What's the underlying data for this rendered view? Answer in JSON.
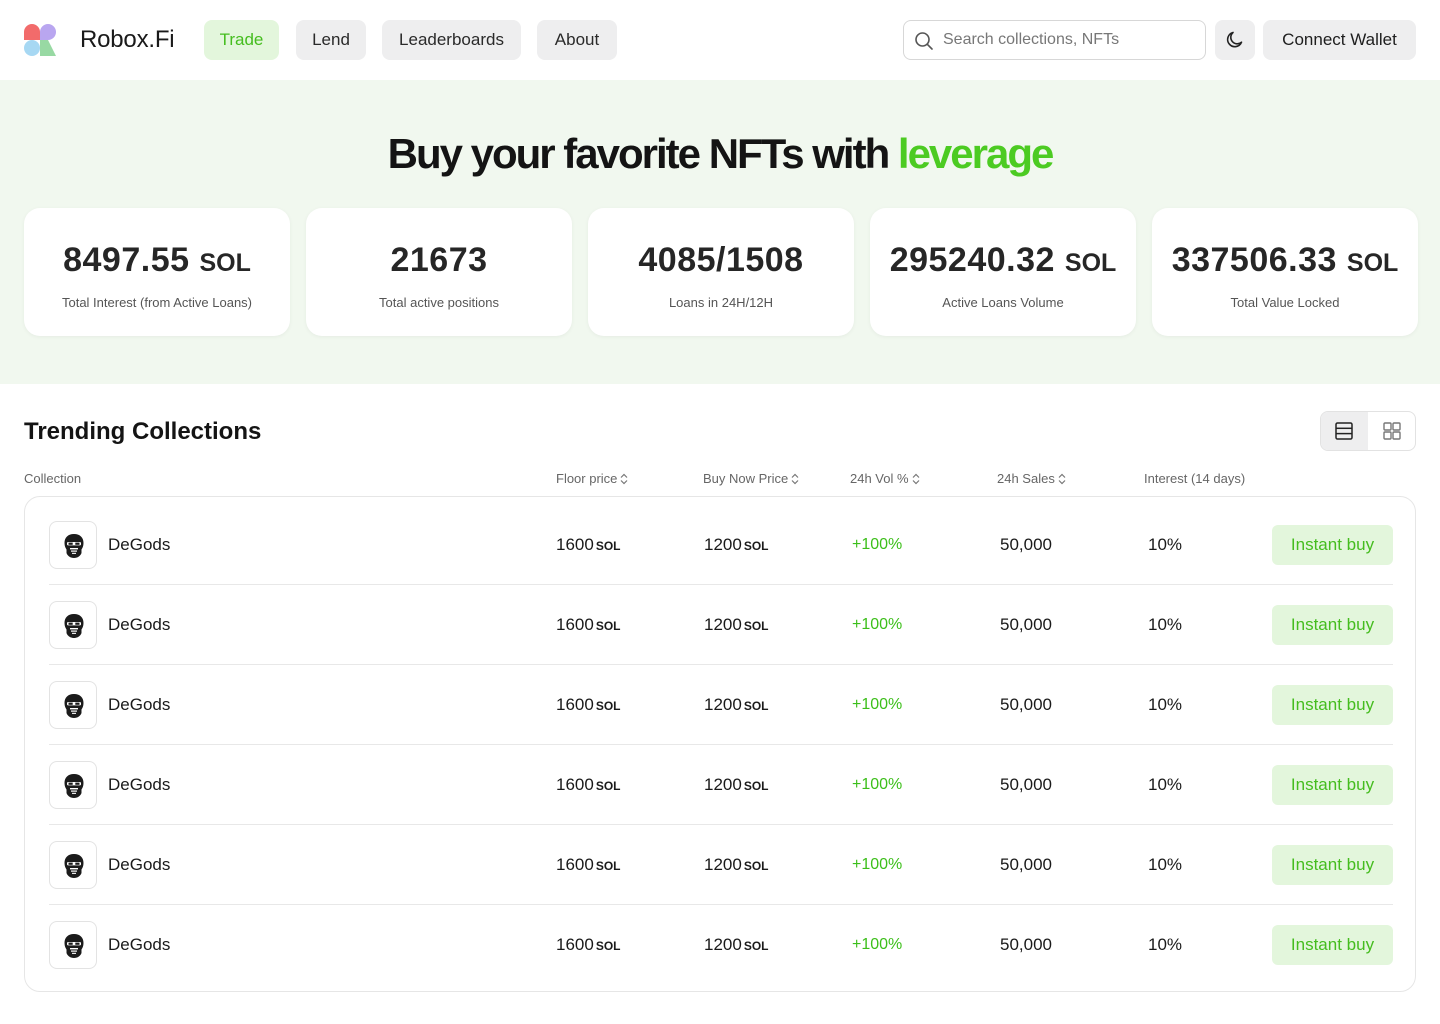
{
  "header": {
    "brand": "Robox.Fi",
    "nav": [
      {
        "label": "Trade",
        "active": true
      },
      {
        "label": "Lend",
        "active": false
      },
      {
        "label": "Leaderboards",
        "active": false
      },
      {
        "label": "About",
        "active": false
      }
    ],
    "search": {
      "placeholder": "Search collections, NFTs",
      "icon": "search-icon"
    },
    "theme_icon": "moon-icon",
    "connect_wallet": "Connect Wallet"
  },
  "hero": {
    "title_prefix": "Buy your favorite NFTs with",
    "title_accent": "leverage",
    "stats": [
      {
        "value": "8497.55",
        "unit": "SOL",
        "label": "Total Interest (from Active Loans)"
      },
      {
        "value": "21673",
        "unit": "",
        "label": "Total active positions"
      },
      {
        "value": "4085/1508",
        "unit": "",
        "label": "Loans in 24H/12H"
      },
      {
        "value": "295240.32",
        "unit": "SOL",
        "label": "Active Loans Volume"
      },
      {
        "value": "337506.33",
        "unit": "SOL",
        "label": "Total Value Locked"
      }
    ]
  },
  "trending": {
    "title": "Trending Collections",
    "view_modes": [
      "list-view-icon",
      "grid-view-icon"
    ],
    "columns": {
      "collection": "Collection",
      "floor": "Floor price",
      "buy_now": "Buy Now Price",
      "vol": "24h Vol %",
      "sales": "24h Sales",
      "interest": "Interest (14 days)"
    },
    "rows": [
      {
        "name": "DeGods",
        "floor": "1600",
        "floor_unit": "SOL",
        "buy_now": "1200",
        "buy_now_unit": "SOL",
        "vol": "+100%",
        "sales": "50,000",
        "interest": "10%",
        "action": "Instant buy"
      },
      {
        "name": "DeGods",
        "floor": "1600",
        "floor_unit": "SOL",
        "buy_now": "1200",
        "buy_now_unit": "SOL",
        "vol": "+100%",
        "sales": "50,000",
        "interest": "10%",
        "action": "Instant buy"
      },
      {
        "name": "DeGods",
        "floor": "1600",
        "floor_unit": "SOL",
        "buy_now": "1200",
        "buy_now_unit": "SOL",
        "vol": "+100%",
        "sales": "50,000",
        "interest": "10%",
        "action": "Instant buy"
      },
      {
        "name": "DeGods",
        "floor": "1600",
        "floor_unit": "SOL",
        "buy_now": "1200",
        "buy_now_unit": "SOL",
        "vol": "+100%",
        "sales": "50,000",
        "interest": "10%",
        "action": "Instant buy"
      },
      {
        "name": "DeGods",
        "floor": "1600",
        "floor_unit": "SOL",
        "buy_now": "1200",
        "buy_now_unit": "SOL",
        "vol": "+100%",
        "sales": "50,000",
        "interest": "10%",
        "action": "Instant buy"
      },
      {
        "name": "DeGods",
        "floor": "1600",
        "floor_unit": "SOL",
        "buy_now": "1200",
        "buy_now_unit": "SOL",
        "vol": "+100%",
        "sales": "50,000",
        "interest": "10%",
        "action": "Instant buy"
      }
    ]
  },
  "colors": {
    "accent": "#4ccb22",
    "accent_bg": "#e3f6dc",
    "hero_bg": "#f1f8ef"
  }
}
